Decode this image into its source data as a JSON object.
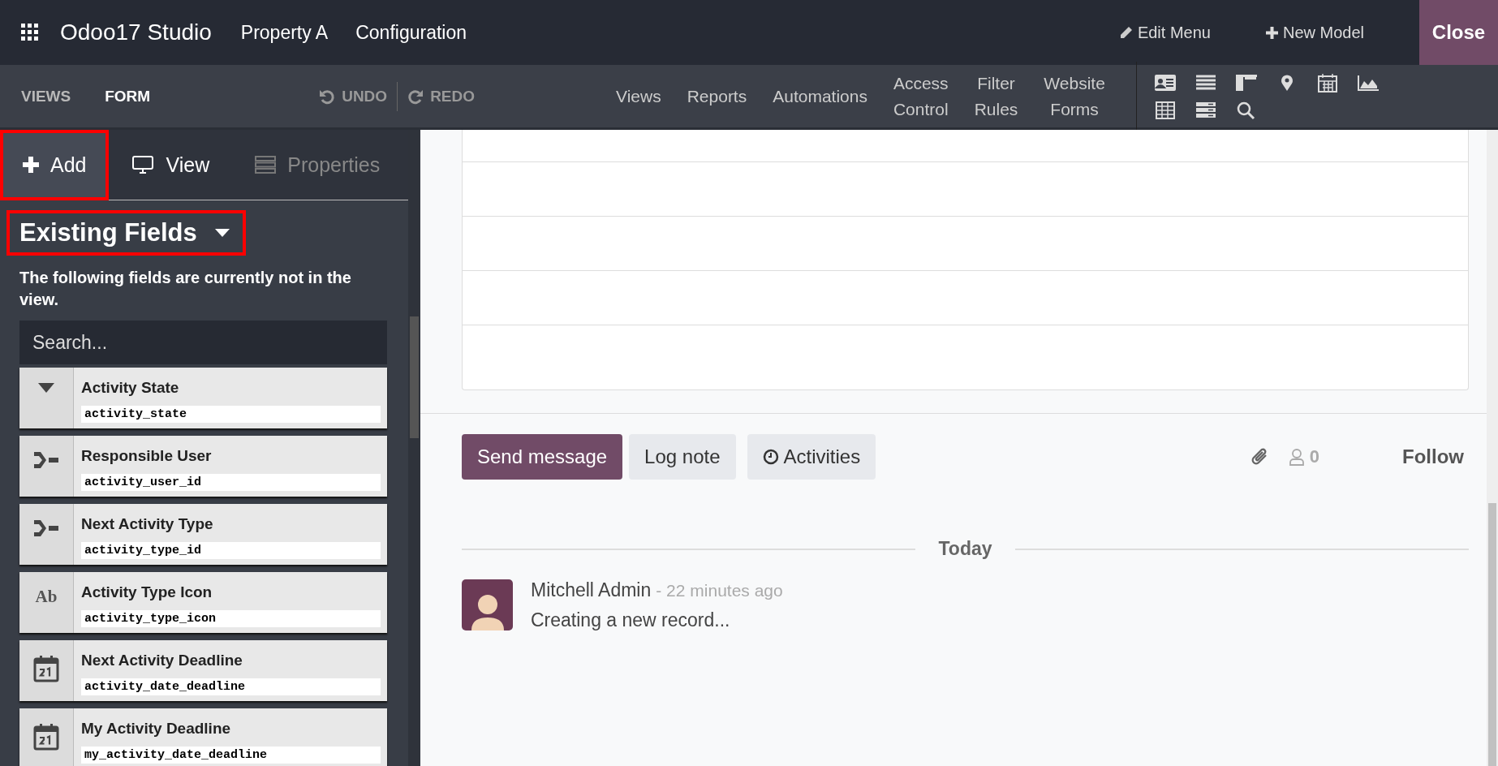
{
  "navbar": {
    "brand": "Odoo17 Studio",
    "menus": [
      "Property A",
      "Configuration"
    ],
    "edit_menu": "Edit Menu",
    "new_model": "New Model",
    "close": "Close"
  },
  "subbar": {
    "breadcrumbs": [
      {
        "label": "VIEWS",
        "selected": false
      },
      {
        "label": "FORM",
        "selected": true
      }
    ],
    "undo": {
      "label": "UNDO",
      "disabled": true
    },
    "redo": {
      "label": "REDO",
      "disabled": true
    },
    "menu": [
      "Views",
      "Reports",
      "Automations",
      "Access Control",
      "Filter Rules",
      "Website Forms"
    ]
  },
  "sidebar": {
    "tabs": [
      {
        "label": "Add",
        "kind": "add",
        "selected": true,
        "disabled": false,
        "highlighted": true
      },
      {
        "label": "View",
        "kind": "view",
        "selected": false,
        "disabled": false,
        "highlighted": false
      },
      {
        "label": "Properties",
        "kind": "properties",
        "selected": false,
        "disabled": true,
        "highlighted": false
      }
    ],
    "section": {
      "title": "Existing Fields",
      "highlighted": true
    },
    "description": "The following fields are currently not in the view.",
    "search": {
      "placeholder": "Search..."
    },
    "fields": [
      {
        "kind": "selection",
        "label": "Activity State",
        "name": "activity_state"
      },
      {
        "kind": "many2one",
        "label": "Responsible User",
        "name": "activity_user_id"
      },
      {
        "kind": "many2one",
        "label": "Next Activity Type",
        "name": "activity_type_id"
      },
      {
        "kind": "char",
        "icon": "Ab",
        "label": "Activity Type Icon",
        "name": "activity_type_icon"
      },
      {
        "kind": "date",
        "label": "Next Activity Deadline",
        "name": "activity_date_deadline"
      },
      {
        "kind": "date",
        "label": "My Activity Deadline",
        "name": "my_activity_date_deadline"
      }
    ]
  },
  "chatter": {
    "send_message": "Send message",
    "log_note": "Log note",
    "activities": "Activities",
    "followers": "0",
    "follow": "Follow",
    "date_separator": "Today",
    "messages": [
      {
        "author": "Mitchell Admin",
        "time": "- 22 minutes ago",
        "body": "Creating a new record..."
      }
    ]
  }
}
